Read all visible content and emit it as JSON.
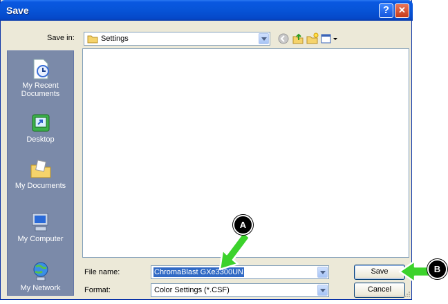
{
  "window": {
    "title": "Save"
  },
  "toolbar": {
    "save_in_label": "Save in:",
    "save_in_value": "Settings"
  },
  "places": [
    {
      "label": "My Recent Documents",
      "icon": "recent-documents-icon"
    },
    {
      "label": "Desktop",
      "icon": "desktop-icon"
    },
    {
      "label": "My Documents",
      "icon": "my-documents-icon"
    },
    {
      "label": "My Computer",
      "icon": "my-computer-icon"
    },
    {
      "label": "My Network",
      "icon": "my-network-icon"
    }
  ],
  "form": {
    "file_name_label": "File name:",
    "file_name_value": "ChromaBlast GXe3300UN",
    "format_label": "Format:",
    "format_value": "Color Settings (*.CSF)"
  },
  "buttons": {
    "save": "Save",
    "cancel": "Cancel"
  },
  "callouts": {
    "a": "A",
    "b": "B"
  },
  "colors": {
    "callout_arrow": "#3cd22c",
    "selection": "#316ac5",
    "title_bar": "#0754d7"
  }
}
